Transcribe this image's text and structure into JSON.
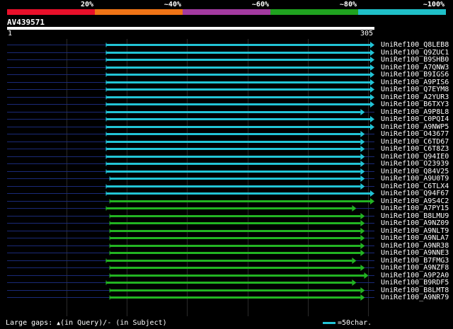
{
  "scale": {
    "labels": [
      {
        "text": "20%",
        "pos": 0.2
      },
      {
        "text": "~40%",
        "pos": 0.4
      },
      {
        "text": "~60%",
        "pos": 0.6
      },
      {
        "text": "~80%",
        "pos": 0.8
      },
      {
        "text": "~100%",
        "pos": 1.0
      }
    ],
    "segments": [
      {
        "color": "#e8102a"
      },
      {
        "color": "#ef7416"
      },
      {
        "color": "#a33aa0"
      },
      {
        "color": "#1fa21f"
      },
      {
        "color": "#1fbfc8"
      }
    ]
  },
  "query": {
    "name": "AV439571",
    "start": "1",
    "end": "305",
    "length": 305
  },
  "hits": [
    {
      "name": "UniRef100_Q8LEB8",
      "start": 83,
      "end": 305,
      "color": "#22c4d6"
    },
    {
      "name": "UniRef100_Q9ZUC1",
      "start": 83,
      "end": 305,
      "color": "#22c4d6"
    },
    {
      "name": "UniRef100_B9SHB0",
      "start": 83,
      "end": 305,
      "color": "#22c4d6"
    },
    {
      "name": "UniRef100_A7QNW3",
      "start": 83,
      "end": 305,
      "color": "#22c4d6"
    },
    {
      "name": "UniRef100_B9IGS6",
      "start": 83,
      "end": 305,
      "color": "#22c4d6"
    },
    {
      "name": "UniRef100_A9PIS6",
      "start": 83,
      "end": 305,
      "color": "#22c4d6"
    },
    {
      "name": "UniRef100_Q7EYM8",
      "start": 83,
      "end": 305,
      "color": "#22c4d6"
    },
    {
      "name": "UniRef100_A2YUR3",
      "start": 83,
      "end": 305,
      "color": "#22c4d6"
    },
    {
      "name": "UniRef100_B6TXY3",
      "start": 83,
      "end": 305,
      "color": "#22c4d6"
    },
    {
      "name": "UniRef100_A9P8L8",
      "start": 83,
      "end": 297,
      "color": "#22c4d6"
    },
    {
      "name": "UniRef100_C0PQI4",
      "start": 83,
      "end": 305,
      "color": "#22c4d6"
    },
    {
      "name": "UniRef100_A9NWP5",
      "start": 83,
      "end": 305,
      "color": "#22c4d6"
    },
    {
      "name": "UniRef100_O43677",
      "start": 83,
      "end": 297,
      "color": "#22c4d6"
    },
    {
      "name": "UniRef100_C6TD67",
      "start": 83,
      "end": 297,
      "color": "#22c4d6"
    },
    {
      "name": "UniRef100_C6T8Z3",
      "start": 83,
      "end": 297,
      "color": "#22c4d6"
    },
    {
      "name": "UniRef100_Q94IE0",
      "start": 83,
      "end": 297,
      "color": "#22c4d6"
    },
    {
      "name": "UniRef100_O23939",
      "start": 83,
      "end": 297,
      "color": "#22c4d6"
    },
    {
      "name": "UniRef100_Q84V25",
      "start": 83,
      "end": 297,
      "color": "#22c4d6"
    },
    {
      "name": "UniRef100_A9U0T9",
      "start": 86,
      "end": 297,
      "color": "#22c4d6"
    },
    {
      "name": "UniRef100_C6TLX4",
      "start": 83,
      "end": 297,
      "color": "#22c4d6"
    },
    {
      "name": "UniRef100_Q94F67",
      "start": 83,
      "end": 305,
      "color": "#22c4d6"
    },
    {
      "name": "UniRef100_A9S4C2",
      "start": 86,
      "end": 305,
      "color": "#22b422"
    },
    {
      "name": "UniRef100_A7PY15",
      "start": 83,
      "end": 290,
      "color": "#22b422"
    },
    {
      "name": "UniRef100_B8LMU9",
      "start": 86,
      "end": 297,
      "color": "#22b422"
    },
    {
      "name": "UniRef100_A9NZ09",
      "start": 86,
      "end": 297,
      "color": "#22b422"
    },
    {
      "name": "UniRef100_A9NLT9",
      "start": 86,
      "end": 297,
      "color": "#22b422"
    },
    {
      "name": "UniRef100_A9NLA7",
      "start": 86,
      "end": 297,
      "color": "#22b422"
    },
    {
      "name": "UniRef100_A9NR38",
      "start": 86,
      "end": 297,
      "color": "#22b422"
    },
    {
      "name": "UniRef100_A9NNE3",
      "start": 86,
      "end": 297,
      "color": "#22b422"
    },
    {
      "name": "UniRef100_B7FMG3",
      "start": 83,
      "end": 290,
      "color": "#22b422"
    },
    {
      "name": "UniRef100_A9NZF8",
      "start": 86,
      "end": 297,
      "color": "#22b422"
    },
    {
      "name": "UniRef100_A9P2A0",
      "start": 86,
      "end": 300,
      "color": "#22b422"
    },
    {
      "name": "UniRef100_B9RDF5",
      "start": 83,
      "end": 290,
      "color": "#22b422"
    },
    {
      "name": "UniRef100_B8LMT8",
      "start": 86,
      "end": 297,
      "color": "#22b422"
    },
    {
      "name": "UniRef100_A9NR79",
      "start": 86,
      "end": 297,
      "color": "#22b422"
    }
  ],
  "gridlines": [
    50,
    100,
    150,
    200,
    250,
    300
  ],
  "footer": {
    "prefix": "Large gaps:",
    "triangle": "▲",
    "query_text": "(in Query)/",
    "dash": "-",
    "subject_text": " (in Subject)",
    "scale_text": "=50char."
  }
}
